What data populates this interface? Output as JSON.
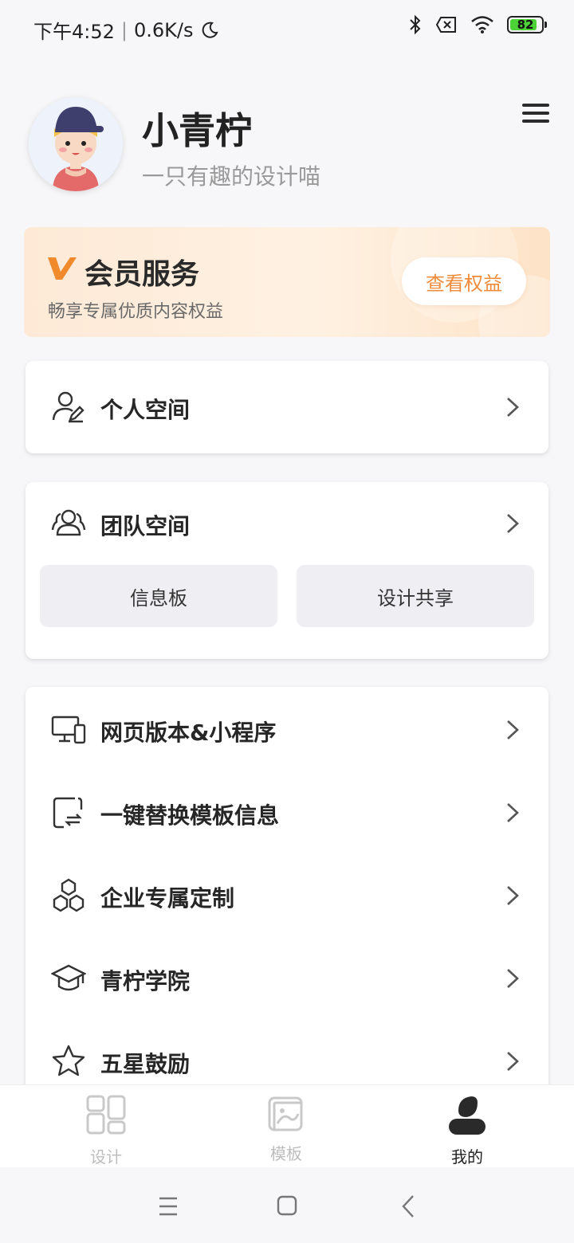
{
  "status_bar": {
    "time": "下午4:52",
    "separator": "|",
    "speed": "0.6K/s",
    "battery": "82",
    "battery_color": "#4cd137"
  },
  "profile": {
    "name": "小青柠",
    "bio": "一只有趣的设计喵"
  },
  "vip": {
    "title": "会员服务",
    "subtitle": "畅享专属优质内容权益",
    "button_label": "查看权益",
    "accent": "#ef8c3c"
  },
  "personal": {
    "label": "个人空间",
    "icon": "user-edit-icon"
  },
  "team": {
    "label": "团队空间",
    "icon": "team-icon",
    "buttons": [
      "信息板",
      "设计共享"
    ]
  },
  "menu_items": [
    {
      "label": "网页版本&小程序",
      "icon": "devices-icon"
    },
    {
      "label": "一键替换模板信息",
      "icon": "replace-icon"
    },
    {
      "label": "企业专属定制",
      "icon": "hexagons-icon"
    },
    {
      "label": "青柠学院",
      "icon": "graduation-cap-icon"
    },
    {
      "label": "五星鼓励",
      "icon": "star-icon"
    }
  ],
  "tabs": [
    {
      "label": "设计",
      "icon": "grid-icon",
      "active": false
    },
    {
      "label": "模板",
      "icon": "template-icon",
      "active": false
    },
    {
      "label": "我的",
      "icon": "profile-icon",
      "active": true
    }
  ]
}
